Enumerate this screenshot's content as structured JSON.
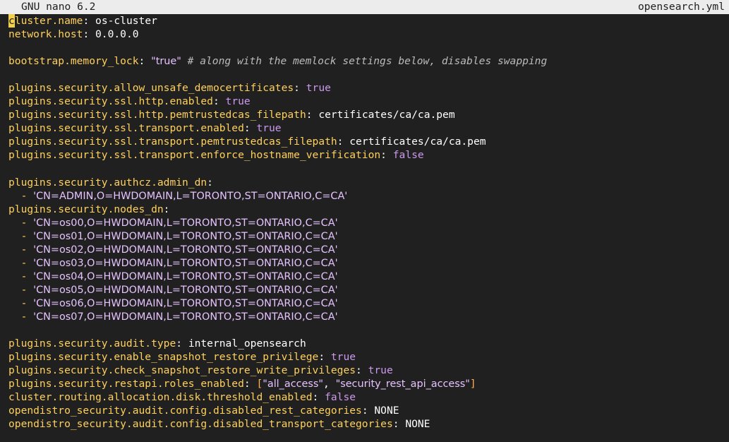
{
  "titlebar": {
    "app": "GNU nano 6.2",
    "filename": "opensearch.yml"
  },
  "lines": [
    [
      {
        "t": "c",
        "k": "cursor"
      },
      {
        "t": "luster.name",
        "k": "key"
      },
      {
        "t": ": ",
        "k": "colon"
      },
      {
        "t": "os-cluster",
        "k": "plain"
      }
    ],
    [
      {
        "t": "network.host",
        "k": "key"
      },
      {
        "t": ": ",
        "k": "colon"
      },
      {
        "t": "0.0.0.0",
        "k": "plain"
      }
    ],
    [],
    [
      {
        "t": "bootstrap.memory_lock",
        "k": "key"
      },
      {
        "t": ": ",
        "k": "colon"
      },
      {
        "t": "\"true\"",
        "k": "str"
      },
      {
        "t": " # along with the memlock settings below, disables swapping",
        "k": "comment"
      }
    ],
    [],
    [
      {
        "t": "plugins.security.allow_unsafe_democertificates",
        "k": "key"
      },
      {
        "t": ": ",
        "k": "colon"
      },
      {
        "t": "true",
        "k": "bool"
      }
    ],
    [
      {
        "t": "plugins.security.ssl.http.enabled",
        "k": "key"
      },
      {
        "t": ": ",
        "k": "colon"
      },
      {
        "t": "true",
        "k": "bool"
      }
    ],
    [
      {
        "t": "plugins.security.ssl.http.pemtrustedcas_filepath",
        "k": "key"
      },
      {
        "t": ": ",
        "k": "colon"
      },
      {
        "t": "certificates/ca/ca.pem",
        "k": "plain"
      }
    ],
    [
      {
        "t": "plugins.security.ssl.transport.enabled",
        "k": "key"
      },
      {
        "t": ": ",
        "k": "colon"
      },
      {
        "t": "true",
        "k": "bool"
      }
    ],
    [
      {
        "t": "plugins.security.ssl.transport.pemtrustedcas_filepath",
        "k": "key"
      },
      {
        "t": ": ",
        "k": "colon"
      },
      {
        "t": "certificates/ca/ca.pem",
        "k": "plain"
      }
    ],
    [
      {
        "t": "plugins.security.ssl.transport.enforce_hostname_verification",
        "k": "key"
      },
      {
        "t": ": ",
        "k": "colon"
      },
      {
        "t": "false",
        "k": "bool"
      }
    ],
    [],
    [
      {
        "t": "plugins.security.authcz.admin_dn",
        "k": "key"
      },
      {
        "t": ":",
        "k": "colon"
      }
    ],
    [
      {
        "t": "  - ",
        "k": "dash"
      },
      {
        "t": "'CN=ADMIN,O=HWDOMAIN,L=TORONTO,ST=ONTARIO,C=CA'",
        "k": "str"
      }
    ],
    [
      {
        "t": "plugins.security.nodes_dn",
        "k": "key"
      },
      {
        "t": ":",
        "k": "colon"
      }
    ],
    [
      {
        "t": "  - ",
        "k": "dash"
      },
      {
        "t": "'CN=os00,O=HWDOMAIN,L=TORONTO,ST=ONTARIO,C=CA'",
        "k": "str"
      }
    ],
    [
      {
        "t": "  - ",
        "k": "dash"
      },
      {
        "t": "'CN=os01,O=HWDOMAIN,L=TORONTO,ST=ONTARIO,C=CA'",
        "k": "str"
      }
    ],
    [
      {
        "t": "  - ",
        "k": "dash"
      },
      {
        "t": "'CN=os02,O=HWDOMAIN,L=TORONTO,ST=ONTARIO,C=CA'",
        "k": "str"
      }
    ],
    [
      {
        "t": "  - ",
        "k": "dash"
      },
      {
        "t": "'CN=os03,O=HWDOMAIN,L=TORONTO,ST=ONTARIO,C=CA'",
        "k": "str"
      }
    ],
    [
      {
        "t": "  - ",
        "k": "dash"
      },
      {
        "t": "'CN=os04,O=HWDOMAIN,L=TORONTO,ST=ONTARIO,C=CA'",
        "k": "str"
      }
    ],
    [
      {
        "t": "  - ",
        "k": "dash"
      },
      {
        "t": "'CN=os05,O=HWDOMAIN,L=TORONTO,ST=ONTARIO,C=CA'",
        "k": "str"
      }
    ],
    [
      {
        "t": "  - ",
        "k": "dash"
      },
      {
        "t": "'CN=os06,O=HWDOMAIN,L=TORONTO,ST=ONTARIO,C=CA'",
        "k": "str"
      }
    ],
    [
      {
        "t": "  - ",
        "k": "dash"
      },
      {
        "t": "'CN=os07,O=HWDOMAIN,L=TORONTO,ST=ONTARIO,C=CA'",
        "k": "str"
      }
    ],
    [],
    [
      {
        "t": "plugins.security.audit.type",
        "k": "key"
      },
      {
        "t": ": ",
        "k": "colon"
      },
      {
        "t": "internal_opensearch",
        "k": "plain"
      }
    ],
    [
      {
        "t": "plugins.security.enable_snapshot_restore_privilege",
        "k": "key"
      },
      {
        "t": ": ",
        "k": "colon"
      },
      {
        "t": "true",
        "k": "bool"
      }
    ],
    [
      {
        "t": "plugins.security.check_snapshot_restore_write_privileges",
        "k": "key"
      },
      {
        "t": ": ",
        "k": "colon"
      },
      {
        "t": "true",
        "k": "bool"
      }
    ],
    [
      {
        "t": "plugins.security.restapi.roles_enabled",
        "k": "key"
      },
      {
        "t": ": ",
        "k": "colon"
      },
      {
        "t": "[",
        "k": "quote"
      },
      {
        "t": "\"all_access\"",
        "k": "str"
      },
      {
        "t": ", ",
        "k": "plain"
      },
      {
        "t": "\"security_rest_api_access\"",
        "k": "str"
      },
      {
        "t": "]",
        "k": "quote"
      }
    ],
    [
      {
        "t": "cluster.routing.allocation.disk.threshold_enabled",
        "k": "key"
      },
      {
        "t": ": ",
        "k": "colon"
      },
      {
        "t": "false",
        "k": "bool"
      }
    ],
    [
      {
        "t": "opendistro_security.audit.config.disabled_rest_categories",
        "k": "key"
      },
      {
        "t": ": ",
        "k": "colon"
      },
      {
        "t": "NONE",
        "k": "plain"
      }
    ],
    [
      {
        "t": "opendistro_security.audit.config.disabled_transport_categories",
        "k": "key"
      },
      {
        "t": ": ",
        "k": "colon"
      },
      {
        "t": "NONE",
        "k": "plain"
      }
    ]
  ],
  "colors": {
    "background": "#202020",
    "titlebar": "#ececec",
    "key": "#ffd15c",
    "bool": "#cc99ee",
    "string": "#e6c3ff",
    "comment": "#bbbbbb",
    "cursor": "#f2d04a"
  }
}
